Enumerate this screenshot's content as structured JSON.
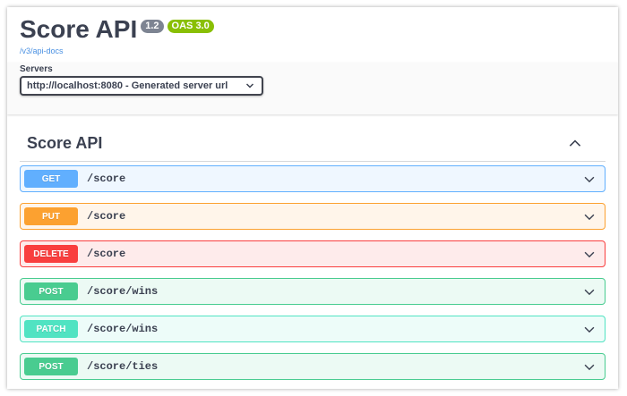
{
  "info": {
    "title": "Score API",
    "version": "1.2",
    "oas": "OAS 3.0",
    "docs_link": "/v3/api-docs"
  },
  "servers": {
    "label": "Servers",
    "selected": "http://localhost:8080 - Generated server url"
  },
  "tag": {
    "title": "Score API"
  },
  "operations": [
    {
      "method": "GET",
      "path": "/score"
    },
    {
      "method": "PUT",
      "path": "/score"
    },
    {
      "method": "DELETE",
      "path": "/score"
    },
    {
      "method": "POST",
      "path": "/score/wins"
    },
    {
      "method": "PATCH",
      "path": "/score/wins"
    },
    {
      "method": "POST",
      "path": "/score/ties"
    }
  ],
  "colors": {
    "get": "#61affe",
    "put": "#fca130",
    "delete": "#f93e3e",
    "post": "#49cc90",
    "patch": "#50e3c2",
    "version_badge": "#7d8492",
    "oas_badge": "#89bf04"
  },
  "icons": {
    "server_dropdown": "chevron-down-icon",
    "tag_toggle": "chevron-up-icon",
    "operation_toggle": "chevron-down-icon"
  }
}
